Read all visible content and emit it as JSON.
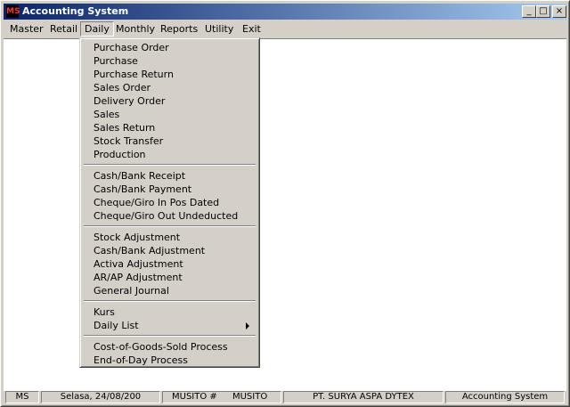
{
  "window": {
    "title": "Accounting System",
    "title_controls": [
      "_",
      "□",
      "×"
    ]
  },
  "menubar": {
    "items": [
      "Master",
      "Retail",
      "Daily",
      "Monthly",
      "Reports",
      "Utility",
      "Exit"
    ],
    "active": "Daily"
  },
  "daily_menu": {
    "groups": [
      [
        "Purchase Order",
        "Purchase",
        "Purchase Return",
        "Sales Order",
        "Delivery Order",
        "Sales",
        "Sales Return",
        "Stock Transfer",
        "Production"
      ],
      [
        "Cash/Bank Receipt",
        "Cash/Bank Payment",
        "Cheque/Giro In Pos Dated",
        "Cheque/Giro Out Undeducted"
      ],
      [
        "Stock Adjustment",
        "Cash/Bank Adjustment",
        "Activa Adjustment",
        "AR/AP Adjustment",
        "General Journal"
      ],
      [
        "Kurs",
        "Daily List"
      ],
      [
        "Cost-of-Goods-Sold Process",
        "End-of-Day Process"
      ]
    ]
  },
  "statusbar": {
    "panels": [
      "MS",
      "Selasa, 24/08/200",
      "MUSITO #",
      "MUSITO",
      "PT. SURYA ASPA DYTEX",
      "Accounting System"
    ]
  },
  "icons": {
    "app": "app-icon",
    "submenu": "submenu-arrow-icon"
  }
}
